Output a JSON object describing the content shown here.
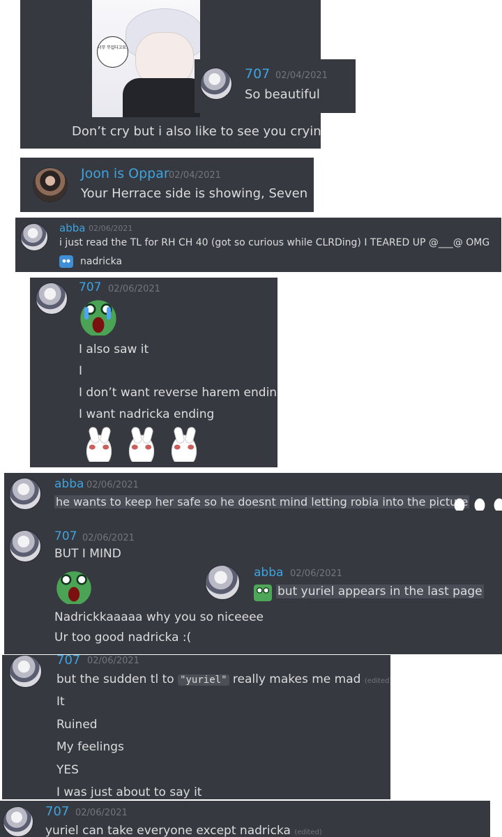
{
  "messages": [
    {
      "author": "707",
      "date": "02/04/2021",
      "lines": [
        "So beautiful"
      ]
    },
    {
      "caption": "Don’t cry but i also like to see you crying",
      "image_text": "너무\n무섭다고요."
    },
    {
      "author": "Joon is Oppar",
      "date": "02/04/2021",
      "lines": [
        "Your Herrace side is showing, Seven"
      ]
    },
    {
      "author": "abba",
      "date": "02/06/2021",
      "lines": [
        "i just read the TL for RH CH 40 (got so curious while CLRDing) I TEARED UP @___@ OMG",
        "nadricka"
      ]
    },
    {
      "author": "707",
      "date": "02/06/2021",
      "lines": [
        "I also saw it",
        "I",
        "I don’t want reverse harem ending",
        "I want nadricka ending"
      ]
    },
    {
      "author": "abba",
      "date": "02/06/2021",
      "lines": [
        "he wants to keep her safe so he doesnt mind letting robia into the picture"
      ]
    },
    {
      "author": "707",
      "date": "02/06/2021",
      "lines": [
        "BUT I MIND",
        "Nadrickkaaaaa why you so niceeee",
        "Ur too good nadricka :("
      ]
    },
    {
      "author": "abba",
      "date": "02/06/2021",
      "lines": [
        "but yuriel appears in the last page"
      ]
    },
    {
      "author": "707",
      "date": "02/06/2021",
      "lines": [
        "but the sudden tl to ",
        "\"yuriel\"",
        " really makes me mad",
        "It",
        "Ruined",
        "My feelings",
        "YES",
        "I was just about to say it"
      ],
      "edited": "(edited)"
    },
    {
      "author": "707",
      "date": "02/06/2021",
      "lines": [
        "yuriel can take everyone except nadricka"
      ],
      "edited": "(edited)"
    }
  ],
  "icons": {
    "avatar_707": "avatar-silver-hair",
    "avatar_joon": "avatar-dark-hair",
    "reaction": "bunny-crying-emoji",
    "frog": "crying-frog-emoji"
  },
  "colors": {
    "background": "#36393f",
    "username": "#3ea4e0",
    "timestamp": "#72767d",
    "text": "#dcddde"
  }
}
